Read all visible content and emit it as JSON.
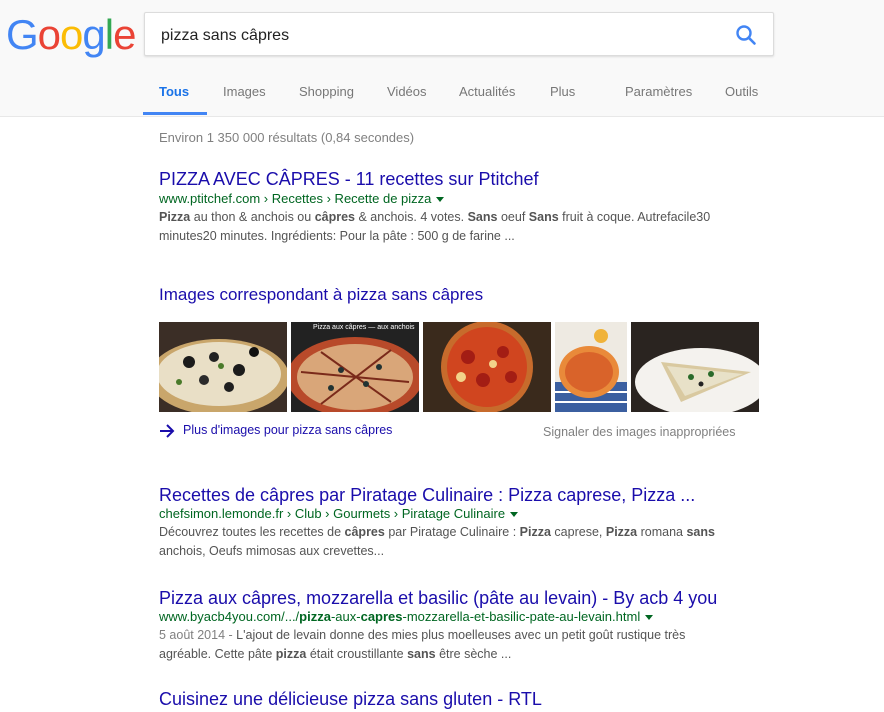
{
  "logo": {
    "letters": [
      "G",
      "o",
      "o",
      "g",
      "l",
      "e"
    ],
    "colors": [
      "#4285f4",
      "#ea4335",
      "#fbbc05",
      "#4285f4",
      "#34a853",
      "#ea4335"
    ]
  },
  "search": {
    "query": "pizza sans câpres"
  },
  "tabs": [
    {
      "label": "Tous",
      "active": true
    },
    {
      "label": "Images"
    },
    {
      "label": "Shopping"
    },
    {
      "label": "Vidéos"
    },
    {
      "label": "Actualités"
    },
    {
      "label": "Plus"
    },
    {
      "label": "Paramètres"
    },
    {
      "label": "Outils"
    }
  ],
  "stats": "Environ 1 350 000 résultats (0,84 secondes)",
  "results": [
    {
      "title": "PIZZA AVEC CÂPRES - 11 recettes sur Ptitchef",
      "url": "www.ptitchef.com › Recettes › Recette de pizza",
      "snippet_line1": "au thon & anchois ou",
      "snippet_b1": "Pizza",
      "snippet_b2": "câpres",
      "snippet_mid1": "& anchois. 4 votes.",
      "snippet_b3": "Sans",
      "snippet_mid2": "oeuf",
      "snippet_b4": "Sans",
      "snippet_end1": "fruit à coque. Autrefacile30",
      "snippet_line2": "minutes20 minutes. Ingrédients: Pour la pâte : 500 g de farine ..."
    },
    {
      "title": "Recettes de câpres par Piratage Culinaire : Pizza caprese, Pizza ...",
      "url": "chefsimon.lemonde.fr › Club › Gourmets › Piratage Culinaire",
      "snippet_a": "Découvrez toutes les recettes de",
      "snippet_b1": "câpres",
      "snippet_c": "par Piratage Culinaire :",
      "snippet_b2": "Pizza",
      "snippet_d": "caprese,",
      "snippet_b3": "Pizza",
      "snippet_e": "romana",
      "snippet_b4": "sans",
      "snippet_line2": "anchois, Oeufs mimosas aux crevettes..."
    },
    {
      "title": "Pizza aux câpres, mozzarella et basilic (pâte au levain) - By acb 4 you",
      "url_a": "www.byacb4you.com/.../",
      "url_b": "pizza",
      "url_c": "-aux-",
      "url_d": "capres",
      "url_e": "-mozzarella-et-basilic-pate-au-levain.html",
      "date": "5 août 2014 -",
      "snippet_a": "L'ajout de levain donne des mies plus moelleuses avec un petit goût rustique très",
      "snippet_b": "agréable. Cette pâte",
      "snippet_b1": "pizza",
      "snippet_c": "était croustillante",
      "snippet_b2": "sans",
      "snippet_d": "être sèche ..."
    },
    {
      "title": "Cuisinez une délicieuse pizza sans gluten - RTL"
    }
  ],
  "images": {
    "header": "Images correspondant à pizza sans câpres",
    "thumb2_caption": "Pizza aux câpres — aux anchois",
    "more_link": "Plus d'images pour pizza sans câpres",
    "report_link": "Signaler des images inappropriées"
  }
}
